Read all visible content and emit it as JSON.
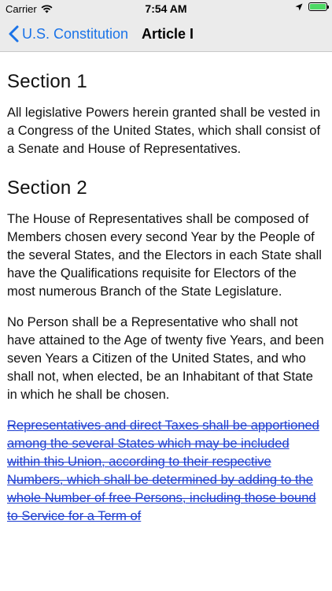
{
  "status_bar": {
    "carrier": "Carrier",
    "time": "7:54 AM",
    "icons": [
      "wifi-icon",
      "location-arrow-icon",
      "battery-icon"
    ],
    "battery_level": 1.0
  },
  "nav": {
    "back_label": "U.S. Constitution",
    "title": "Article I",
    "accent_color": "#1a73e8"
  },
  "sections": [
    {
      "title": "Section 1",
      "paragraphs": [
        "All legislative Powers herein granted shall be vested in a Congress of the United States, which shall consist of a Senate and House of Representatives."
      ]
    },
    {
      "title": "Section 2",
      "paragraphs": [
        "The House of Representatives shall be composed of Members chosen every second Year by the People of the several States, and the Electors in each State shall have the Qualifications requisite for Electors of the most numerous Branch of the State Legislature.",
        "No Person shall be a Representative who shall not have attained to the Age of twenty five Years, and been seven Years a Citizen of the United States, and who shall not, when elected, be an Inhabitant of that State in which he shall be chosen.",
        "Representatives and direct Taxes shall be apportioned among the several States which may be included within this Union, according to their respective Numbers, which shall be determined by adding to the whole Number of free Persons, including those bound to Service for a Term of"
      ]
    }
  ]
}
